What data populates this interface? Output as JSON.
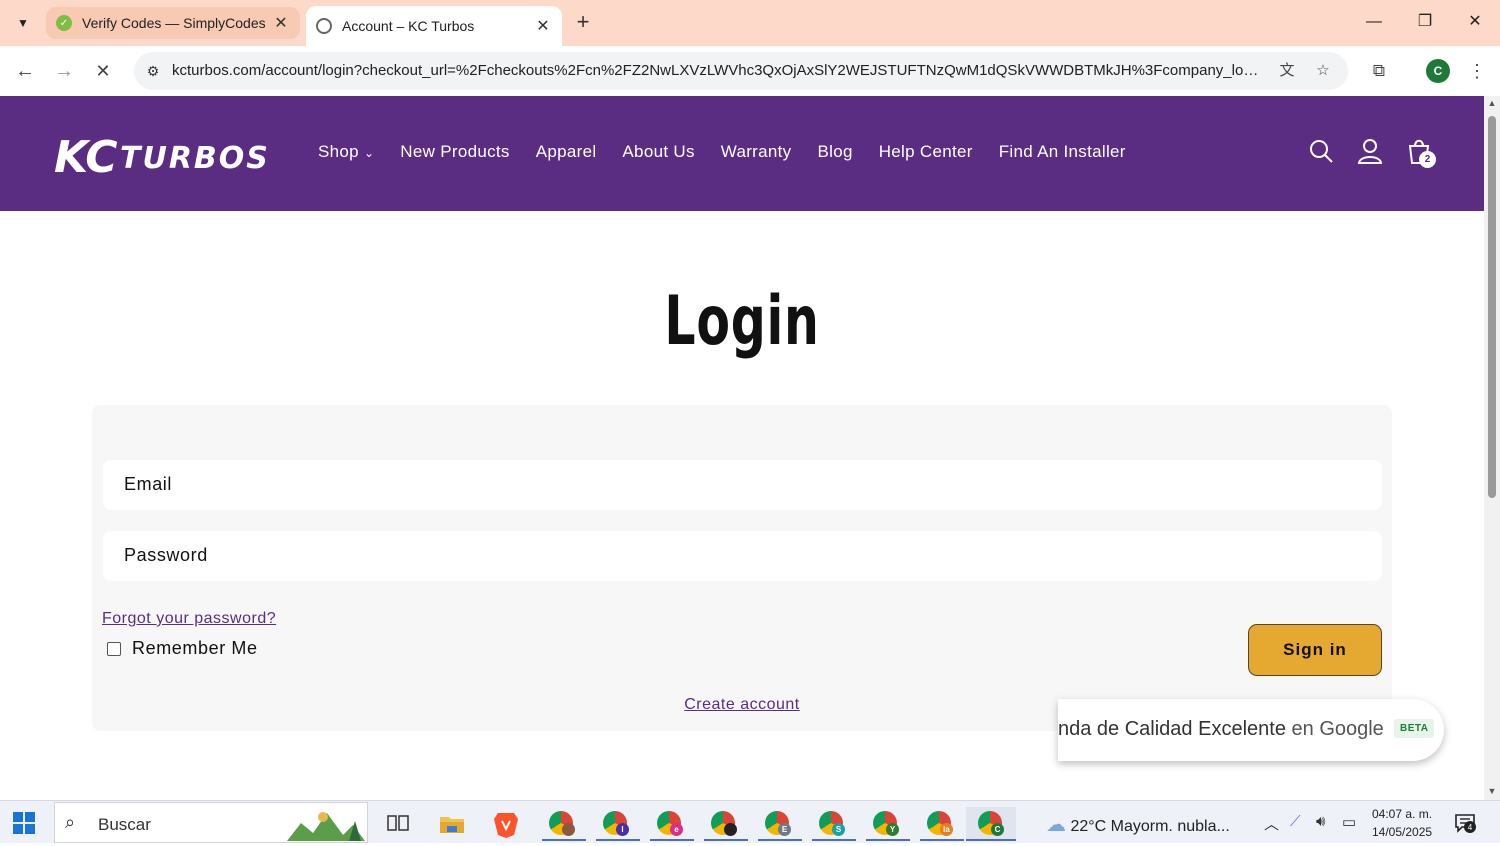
{
  "browser": {
    "tabs": [
      {
        "title": "Verify Codes — SimplyCodes",
        "active": false
      },
      {
        "title": "Account – KC Turbos",
        "active": true
      }
    ],
    "url": "kcturbos.com/account/login?checkout_url=%2Fcheckouts%2Fcn%2FZ2NwLXVzLWVhc3QxOjAxSlY2WEJSTUFTNzQwM1dQSkVWWDBTMkJH%3Fcompany_locati...",
    "profile_initial": "C"
  },
  "site": {
    "brand": "KC TURBOS",
    "nav": [
      "Shop",
      "New Products",
      "Apparel",
      "About Us",
      "Warranty",
      "Blog",
      "Help Center",
      "Find An Installer"
    ],
    "cart_count": "2",
    "colors": {
      "header": "#5b2d82",
      "signin": "#e5a831"
    }
  },
  "login": {
    "title": "Login",
    "email_label": "Email",
    "password_label": "Password",
    "forgot": "Forgot your password?",
    "remember": "Remember Me",
    "signin": "Sign in",
    "create": "Create account"
  },
  "google_badge": {
    "text_prefix": "nda de Calidad Excelente",
    "text_suffix": " en Google",
    "beta": "BETA"
  },
  "taskbar": {
    "search_placeholder": "Buscar",
    "weather": "22°C  Mayorm. nubla...",
    "time": "04:07 a. m.",
    "date": "14/05/2025",
    "notifications": "4",
    "app_letters": [
      "",
      "I",
      "e",
      "",
      "E",
      "S",
      "Y",
      "la",
      "C"
    ]
  }
}
